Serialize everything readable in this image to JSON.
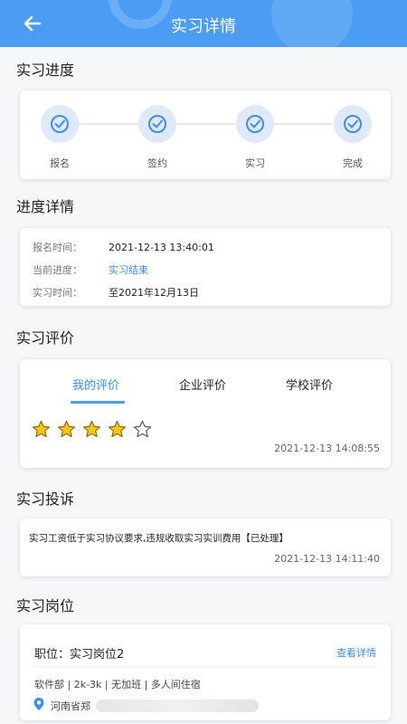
{
  "header": {
    "title": "实习详情"
  },
  "sections": {
    "progress": "实习进度",
    "detail": "进度详情",
    "evaluation": "实习评价",
    "complaint": "实习投诉",
    "job": "实习岗位"
  },
  "progress_steps": [
    "报名",
    "签约",
    "实习",
    "完成"
  ],
  "detail": {
    "signup_label": "报名时间：",
    "signup_value": "2021-12-13 13:40:01",
    "status_label": "当前进度：",
    "status_value": "实习结束",
    "period_label": "实习时间：",
    "period_value": "至2021年12月13日"
  },
  "evaluation": {
    "tabs": [
      "我的评价",
      "企业评价",
      "学校评价"
    ],
    "active_tab": 0,
    "rating": 4,
    "max_rating": 5,
    "time": "2021-12-13 14:08:55"
  },
  "complaint": {
    "text": "实习工资低于实习协议要求,违规收取实习实训费用【已处理】",
    "time": "2021-12-13 14:11:40"
  },
  "job": {
    "title": "职位：实习岗位2",
    "view_details": "查看详情",
    "tags": "软件部 | 2k-3k | 无加班 | 多人间住宿",
    "location": "河南省郑"
  },
  "colors": {
    "primary": "#4a9df3",
    "star": "#f5c518"
  }
}
